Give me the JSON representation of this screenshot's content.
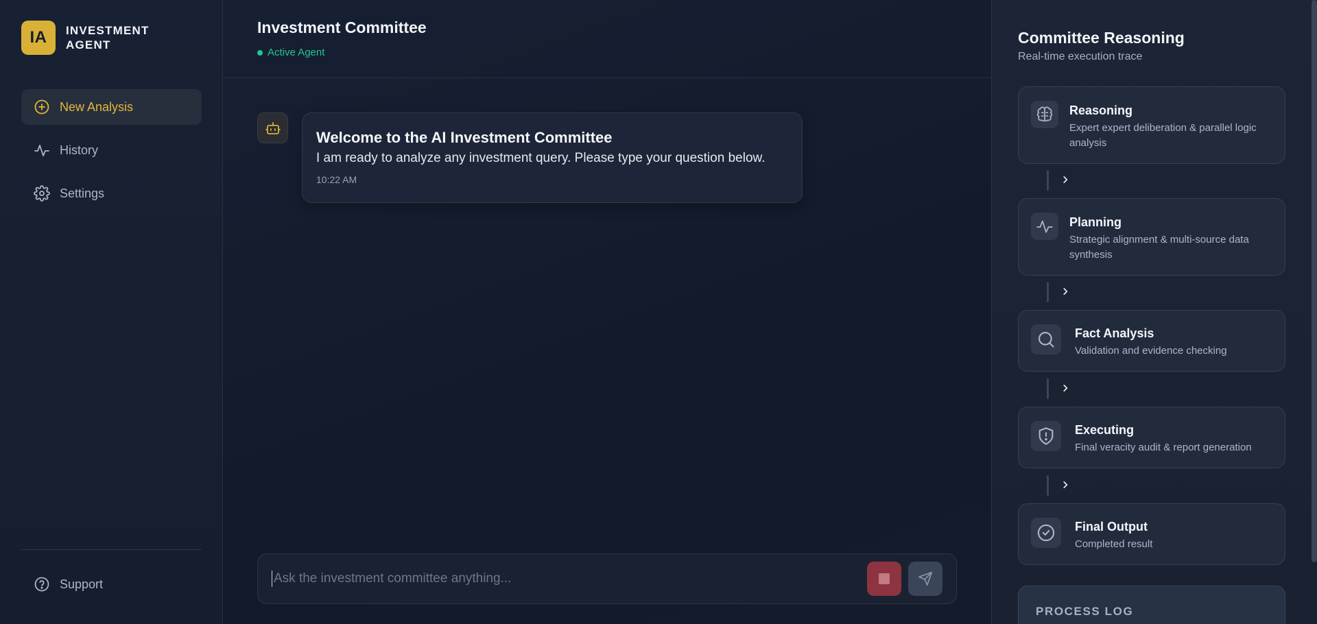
{
  "brand": {
    "logo": "IA",
    "name": "INVESTMENT AGENT"
  },
  "sidebar": {
    "items": [
      {
        "label": "New Analysis",
        "icon": "plus-circle-icon",
        "active": true
      },
      {
        "label": "History",
        "icon": "activity-icon",
        "active": false
      },
      {
        "label": "Settings",
        "icon": "gear-icon",
        "active": false
      }
    ],
    "support_label": "Support"
  },
  "header": {
    "title": "Investment Committee",
    "status": "Active Agent"
  },
  "message": {
    "title": "Welcome to the AI Investment Committee",
    "text": "I am ready to analyze any investment query. Please type your question below.",
    "time": "10:22 AM"
  },
  "composer": {
    "placeholder": "Ask the investment committee anything...",
    "value": ""
  },
  "panel": {
    "title": "Committee Reasoning",
    "subtitle": "Real-time execution trace",
    "steps": [
      {
        "title": "Reasoning",
        "desc": "Expert expert deliberation & parallel logic analysis",
        "icon": "brain-icon"
      },
      {
        "title": "Planning",
        "desc": "Strategic alignment & multi-source data synthesis",
        "icon": "activity-icon"
      },
      {
        "title": "Fact Analysis",
        "desc": "Validation and evidence checking",
        "icon": "search-icon"
      },
      {
        "title": "Executing",
        "desc": "Final veracity audit & report generation",
        "icon": "shield-alert-icon"
      },
      {
        "title": "Final Output",
        "desc": "Completed result",
        "icon": "check-circle-icon"
      }
    ],
    "log_title": "PROCESS LOG"
  },
  "colors": {
    "accent": "#d8b136",
    "status": "#22c58b",
    "stop": "#8e3440"
  }
}
